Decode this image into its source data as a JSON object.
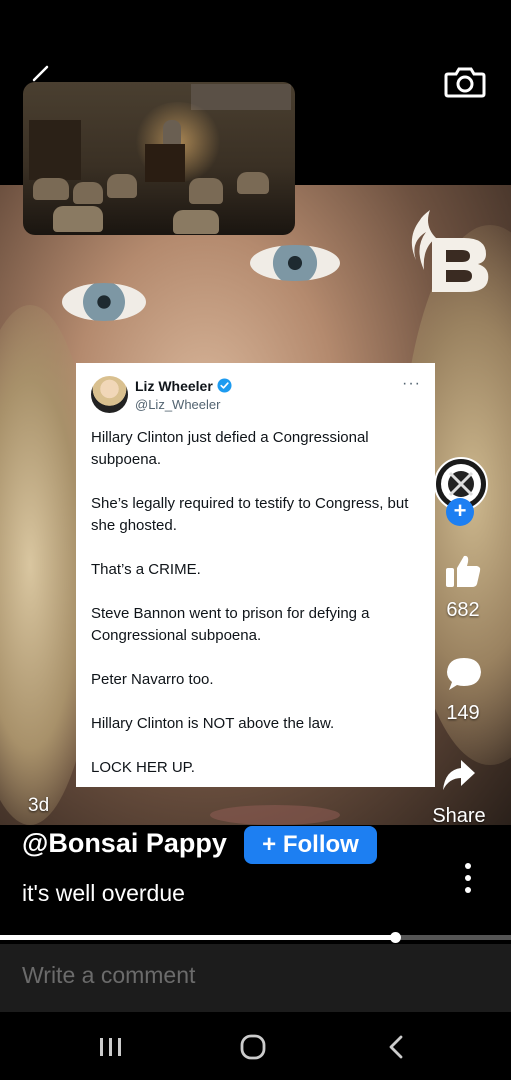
{
  "video": {
    "age": "3d"
  },
  "tweet": {
    "name": "Liz Wheeler",
    "handle": "@Liz_Wheeler",
    "more": "···",
    "lines": [
      "Hillary Clinton just defied a Congressional subpoena.",
      "She’s legally required to testify to Congress, but she ghosted.",
      "That’s a CRIME.",
      "Steve Bannon went to prison for defying a Congressional subpoena.",
      "Peter Navarro too.",
      "Hillary Clinton is NOT above the law.",
      "LOCK HER UP."
    ]
  },
  "rail": {
    "follow_plus": "+",
    "likes": "682",
    "comments": "149",
    "share_label": "Share"
  },
  "post": {
    "author": "@Bonsai Pappy",
    "follow_label": "+ Follow",
    "caption": "it's well overdue"
  },
  "playback": {
    "progress": 0.773
  },
  "comment": {
    "placeholder": "Write a comment"
  },
  "icons": {
    "back": "back-arrow-icon",
    "camera": "camera-icon",
    "like": "thumbs-up-icon",
    "comment": "speech-bubble-icon",
    "share": "share-arrow-icon",
    "more": "vertical-dots-icon",
    "verified": "verified-badge-icon"
  },
  "colors": {
    "accent": "#1d7ff2",
    "comment_bar": "#1c1c1c"
  }
}
